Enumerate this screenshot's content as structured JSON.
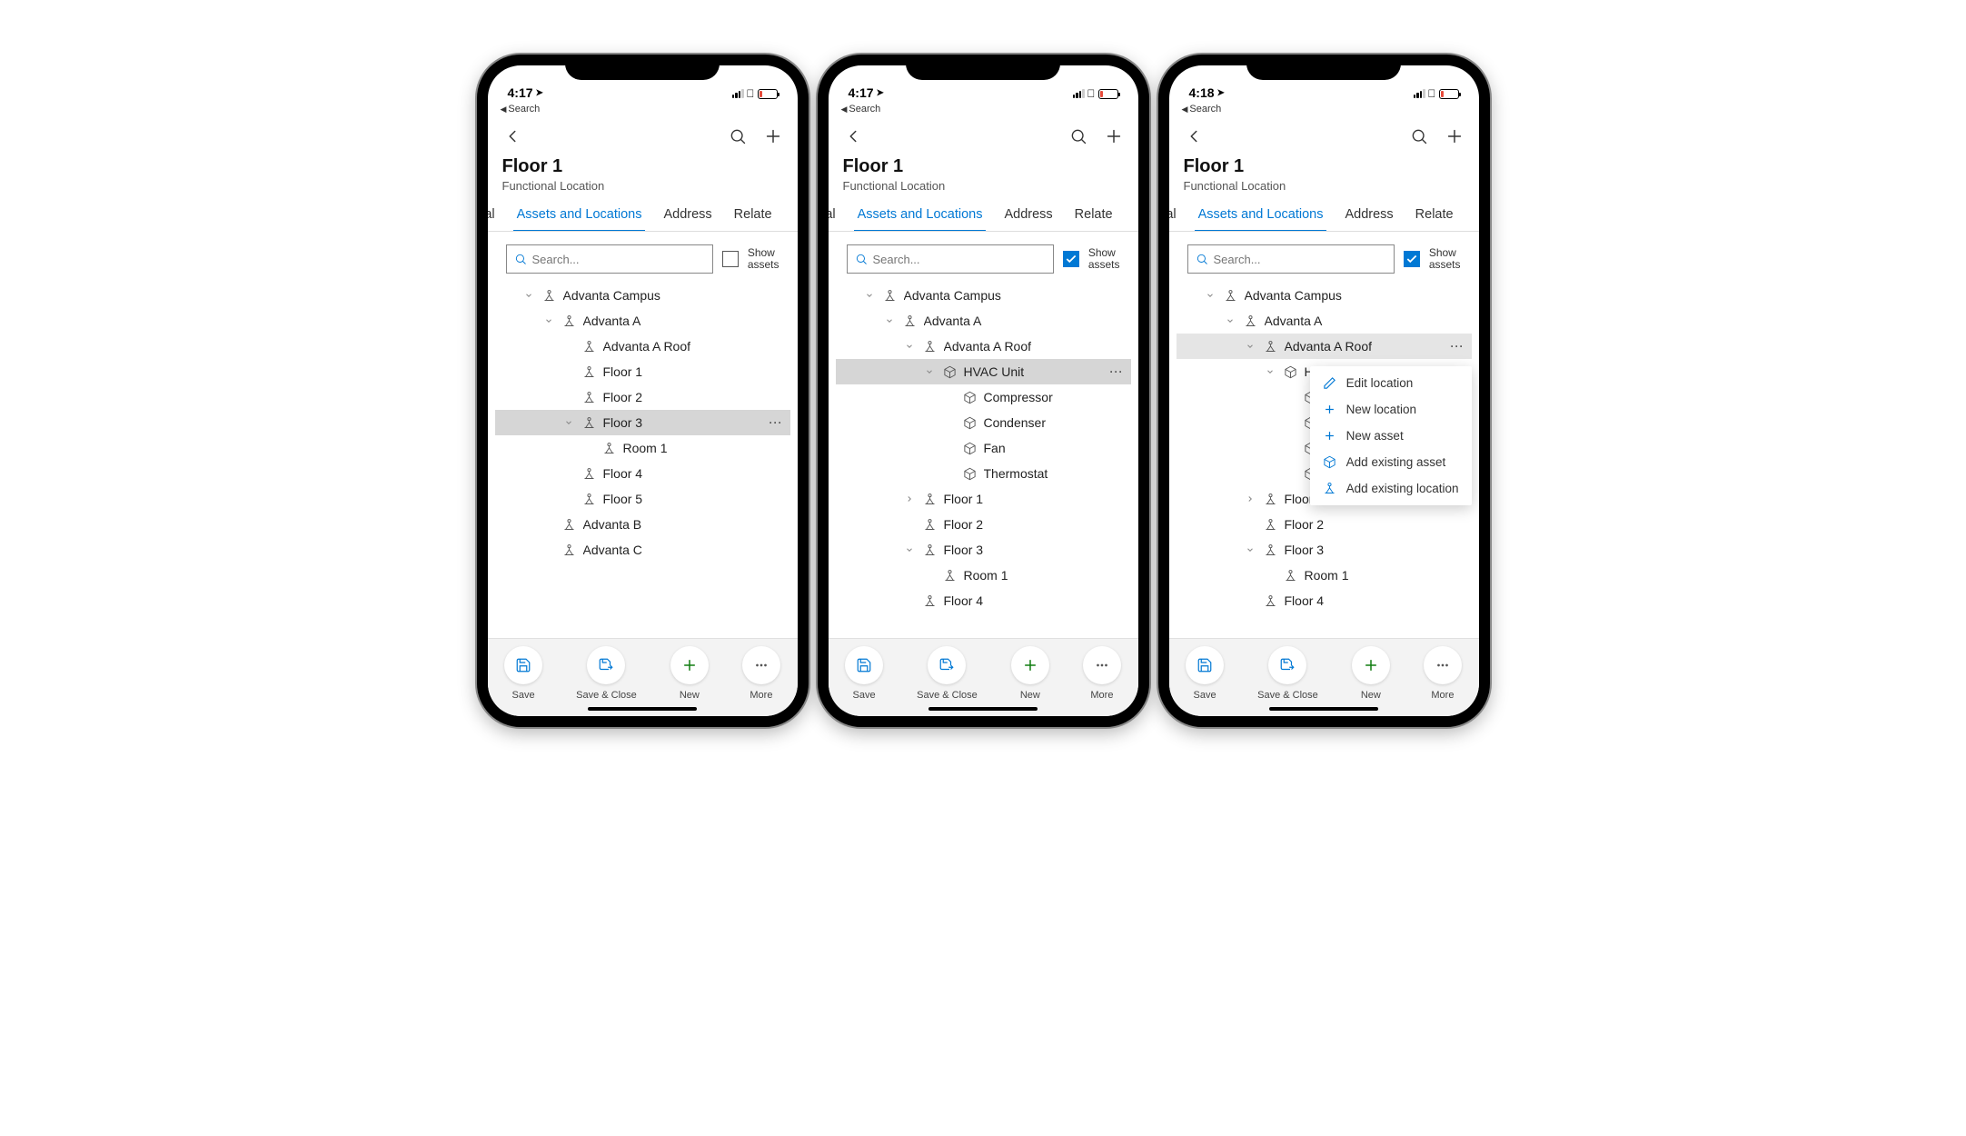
{
  "status": {
    "back_link": "Search"
  },
  "nav": {
    "title": "Floor 1",
    "subtitle": "Functional Location"
  },
  "tabs": {
    "general": "ral",
    "assets": "Assets and Locations",
    "address": "Address",
    "related": "Relate"
  },
  "search": {
    "placeholder": "Search...",
    "show_label_1": "Show",
    "show_label_2": "assets"
  },
  "bottom": {
    "save": "Save",
    "save_close": "Save & Close",
    "new": "New",
    "more": "More"
  },
  "context_menu": {
    "edit_location": "Edit location",
    "new_location": "New location",
    "new_asset": "New asset",
    "add_existing_asset": "Add existing asset",
    "add_existing_location": "Add existing location"
  },
  "phones": [
    {
      "time": "4:17",
      "show_assets_checked": false,
      "tree": [
        {
          "indent": 0,
          "chev": "down",
          "icon": "loc",
          "label": "Advanta Campus"
        },
        {
          "indent": 1,
          "chev": "down",
          "icon": "loc",
          "label": "Advanta A"
        },
        {
          "indent": 2,
          "chev": "",
          "icon": "loc",
          "label": "Advanta A Roof"
        },
        {
          "indent": 2,
          "chev": "",
          "icon": "loc",
          "label": "Floor 1"
        },
        {
          "indent": 2,
          "chev": "",
          "icon": "loc",
          "label": "Floor 2"
        },
        {
          "indent": 2,
          "chev": "down",
          "icon": "loc",
          "label": "Floor 3",
          "selected": true,
          "dots": true
        },
        {
          "indent": 3,
          "chev": "",
          "icon": "loc",
          "label": "Room 1"
        },
        {
          "indent": 2,
          "chev": "",
          "icon": "loc",
          "label": "Floor 4"
        },
        {
          "indent": 2,
          "chev": "",
          "icon": "loc",
          "label": "Floor 5"
        },
        {
          "indent": 1,
          "chev": "",
          "icon": "loc",
          "label": "Advanta B"
        },
        {
          "indent": 1,
          "chev": "",
          "icon": "loc",
          "label": "Advanta C"
        }
      ]
    },
    {
      "time": "4:17",
      "show_assets_checked": true,
      "tree": [
        {
          "indent": 0,
          "chev": "down",
          "icon": "loc",
          "label": "Advanta Campus"
        },
        {
          "indent": 1,
          "chev": "down",
          "icon": "loc",
          "label": "Advanta A"
        },
        {
          "indent": 2,
          "chev": "down",
          "icon": "loc",
          "label": "Advanta A Roof"
        },
        {
          "indent": 3,
          "chev": "down",
          "icon": "asset",
          "label": "HVAC Unit",
          "selected": true,
          "dots": true
        },
        {
          "indent": 4,
          "chev": "",
          "icon": "asset",
          "label": "Compressor"
        },
        {
          "indent": 4,
          "chev": "",
          "icon": "asset",
          "label": "Condenser"
        },
        {
          "indent": 4,
          "chev": "",
          "icon": "asset",
          "label": "Fan"
        },
        {
          "indent": 4,
          "chev": "",
          "icon": "asset",
          "label": "Thermostat"
        },
        {
          "indent": 2,
          "chev": "right",
          "icon": "loc",
          "label": "Floor 1"
        },
        {
          "indent": 2,
          "chev": "",
          "icon": "loc",
          "label": "Floor 2"
        },
        {
          "indent": 2,
          "chev": "down",
          "icon": "loc",
          "label": "Floor 3"
        },
        {
          "indent": 3,
          "chev": "",
          "icon": "loc",
          "label": "Room 1"
        },
        {
          "indent": 2,
          "chev": "",
          "icon": "loc",
          "label": "Floor 4"
        }
      ]
    },
    {
      "time": "4:18",
      "show_assets_checked": true,
      "context_menu_at": 2,
      "tree": [
        {
          "indent": 0,
          "chev": "down",
          "icon": "loc",
          "label": "Advanta Campus"
        },
        {
          "indent": 1,
          "chev": "down",
          "icon": "loc",
          "label": "Advanta A"
        },
        {
          "indent": 2,
          "chev": "down",
          "icon": "loc",
          "label": "Advanta A Roof",
          "selected_light": true,
          "dots": true
        },
        {
          "indent": 3,
          "chev": "down",
          "icon": "asset",
          "label": "H"
        },
        {
          "indent": 4,
          "chev": "",
          "icon": "asset",
          "label": ""
        },
        {
          "indent": 4,
          "chev": "",
          "icon": "asset",
          "label": ""
        },
        {
          "indent": 4,
          "chev": "",
          "icon": "asset",
          "label": ""
        },
        {
          "indent": 4,
          "chev": "",
          "icon": "asset",
          "label": ""
        },
        {
          "indent": 2,
          "chev": "right",
          "icon": "loc",
          "label": "Floor 1"
        },
        {
          "indent": 2,
          "chev": "",
          "icon": "loc",
          "label": "Floor 2"
        },
        {
          "indent": 2,
          "chev": "down",
          "icon": "loc",
          "label": "Floor 3"
        },
        {
          "indent": 3,
          "chev": "",
          "icon": "loc",
          "label": "Room 1"
        },
        {
          "indent": 2,
          "chev": "",
          "icon": "loc",
          "label": "Floor 4"
        }
      ]
    }
  ]
}
